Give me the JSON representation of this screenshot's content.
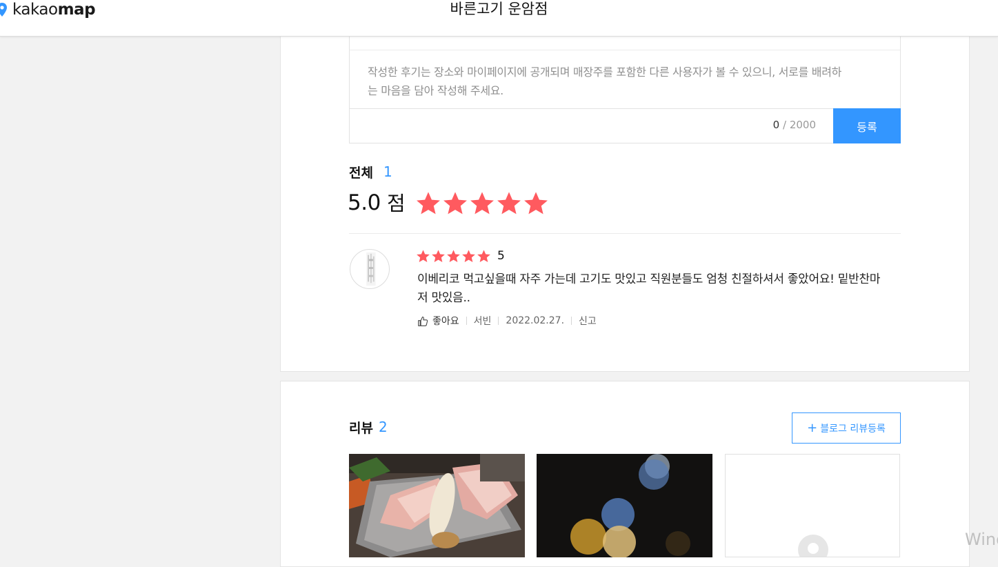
{
  "header": {
    "logo_text_light": "kakao",
    "logo_text_bold": "map",
    "place_name": "바른고기 운암점"
  },
  "write_review": {
    "placeholder": "작성한 후기는 장소와 마이페이지에 공개되며 매장주를 포함한 다른 사용자가 볼 수 있으니, 서로를 배려하는 마음을 담아 작성해 주세요.",
    "char_count": "0",
    "char_limit": "/ 2000",
    "submit_label": "등록"
  },
  "summary": {
    "total_label": "전체",
    "total_count": "1",
    "score": "5.0",
    "score_unit": "점",
    "stars": 5
  },
  "reviews": [
    {
      "rating": 5,
      "rating_text": "5",
      "text": "이베리코 먹고싶을때 자주 가는데 고기도 맛있고 직원분들도 엄청 친절하셔서 좋았어요! 밑반찬마저 맛있음..",
      "like_label": "좋아요",
      "author": "서빈",
      "date": "2022.02.27.",
      "report_label": "신고"
    }
  ],
  "blog_reviews": {
    "label": "리뷰",
    "count": "2",
    "add_button": "블로그 리뷰등록"
  },
  "watermark": "Windows",
  "colors": {
    "accent": "#3396ff",
    "star": "#ff5a5f",
    "header_bg": "#ffffff",
    "page_bg": "#f2f2f2"
  }
}
